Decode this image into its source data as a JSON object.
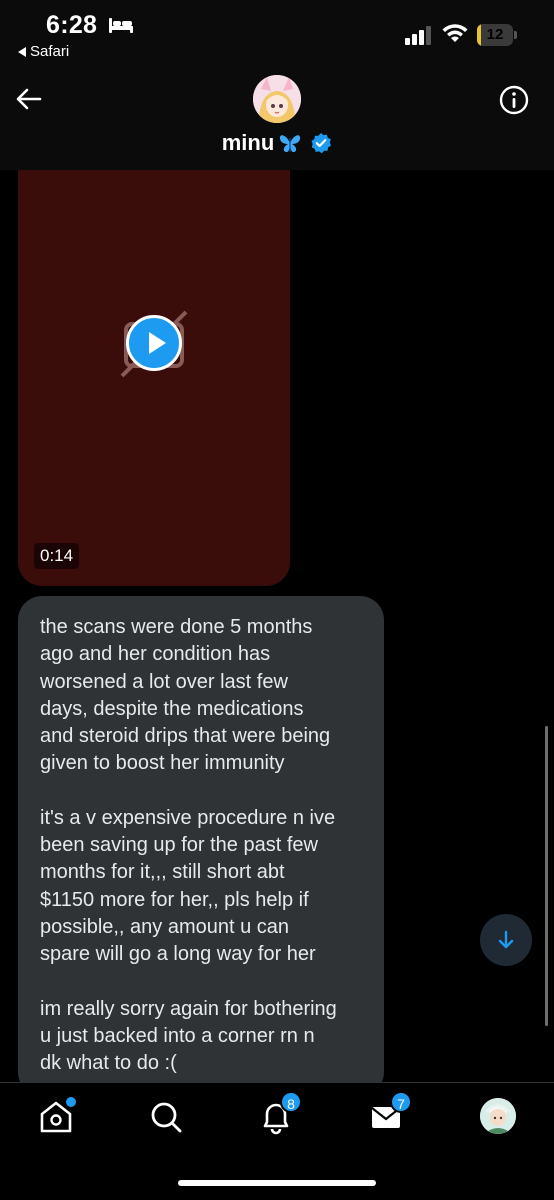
{
  "status_bar": {
    "time": "6:28",
    "back_app_label": "Safari",
    "battery_percent": "12",
    "battery_level": 0.12,
    "icons": [
      "bed-icon",
      "signal-icon",
      "wifi-icon",
      "battery-icon"
    ]
  },
  "header": {
    "contact_name": "minu",
    "name_emoji_icon": "butterfly-icon",
    "verified_icon": "verified-badge-icon",
    "icons": [
      "back-arrow-icon",
      "info-icon"
    ]
  },
  "messages": {
    "video": {
      "duration": "0:14",
      "icons": [
        "play-icon",
        "no-camera-icon"
      ]
    },
    "text_paragraphs": [
      "the scans were done 5 months\nago and her condition has\nworsened a lot over last few\ndays, despite the medications\nand steroid drips that were being\ngiven to boost her immunity",
      "it's a v expensive procedure n ive\nbeen saving up for the past few\nmonths for it,,, still short abt\n$1150 more for her,, pls help if\npossible,, any amount u can\nspare will go a long way for her",
      "im really sorry again for bothering\nu just backed into a corner rn n\ndk what to do :("
    ]
  },
  "scroll_down_icon": "arrow-down-icon",
  "bottom_nav": {
    "items": [
      {
        "icon": "home-icon",
        "badge": ""
      },
      {
        "icon": "search-icon",
        "badge": ""
      },
      {
        "icon": "bell-icon",
        "badge": "8"
      },
      {
        "icon": "mail-icon",
        "badge": "7"
      },
      {
        "icon": "profile-avatar",
        "badge": ""
      }
    ]
  },
  "colors": {
    "accent": "#1d9bf0",
    "bubble_gray": "#2f3336",
    "video_bg": "#3b0d0a",
    "battery_yellow": "#e8c534"
  }
}
